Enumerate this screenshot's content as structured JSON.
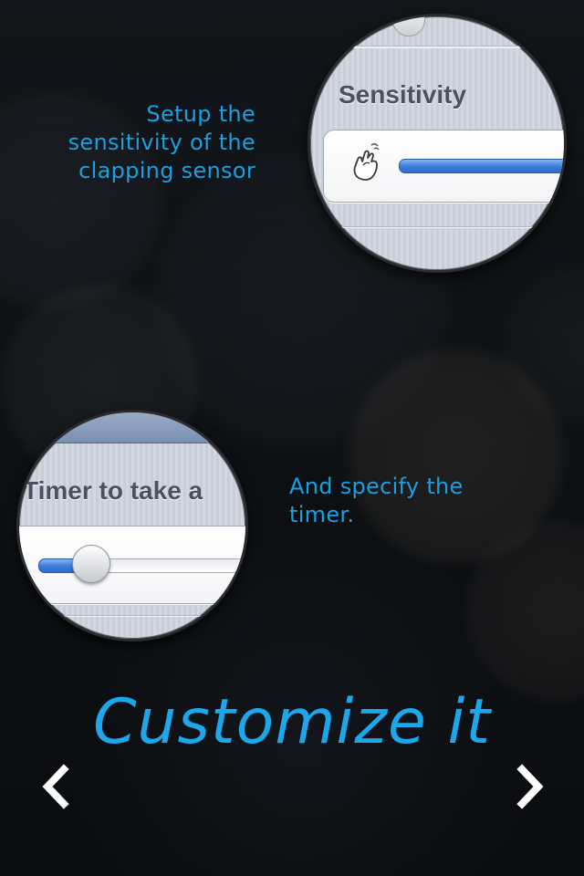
{
  "screen": {
    "background_color": "#0d0f12",
    "accent_color": "#1b9fe0"
  },
  "sensitivity_callout": {
    "caption": "Setup the\nsensitivity of the\nclapping sensor",
    "magnifier": {
      "section_title": "Sensitivity",
      "icon": "clap-hand-icon",
      "slider_color": "#3f7fd8",
      "slider_level": 1.0
    }
  },
  "timer_callout": {
    "caption": "And specify the\ntimer.",
    "magnifier": {
      "section_title": "Timer to take a",
      "slider_color": "#3f7fd8",
      "slider_level": 0.1
    }
  },
  "headline": "Customize it",
  "navigation": {
    "prev_icon": "chevron-left-icon",
    "next_icon": "chevron-right-icon",
    "arrow_color": "#ffffff"
  }
}
